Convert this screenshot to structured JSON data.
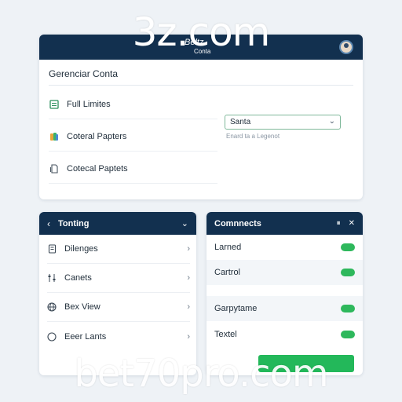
{
  "watermarks": {
    "top": "3z.com",
    "bottom": "bet70pro.com"
  },
  "top_card": {
    "logo": "Beltz",
    "logo_sub": "Conta",
    "title": "Gerenciar Conta",
    "rows": [
      {
        "label": "Full Limites",
        "icon": "sheet-icon"
      },
      {
        "label": "Coteral Papters",
        "icon": "color-swatch-icon"
      },
      {
        "label": "Cotecal Paptets",
        "icon": "file-icon"
      }
    ],
    "select": {
      "value": "Santa"
    },
    "select_hint": "Enard ta a Legenot"
  },
  "left_card": {
    "title": "Tonting",
    "items": [
      {
        "label": "Dilenges",
        "icon": "document-icon"
      },
      {
        "label": "Canets",
        "icon": "sliders-icon"
      },
      {
        "label": "Bex View",
        "icon": "globe-icon"
      },
      {
        "label": "Eeer Lants",
        "icon": "circle-icon"
      }
    ]
  },
  "right_card": {
    "title": "Comnnects",
    "toggles": [
      {
        "label": "Larned",
        "on": true
      },
      {
        "label": "Cartrol",
        "on": true
      },
      {
        "label": "Garpytame",
        "on": true
      },
      {
        "label": "Textel",
        "on": true
      }
    ]
  },
  "colors": {
    "navy": "#12304f",
    "accent_green": "#2eb85c",
    "background": "#eef2f6"
  }
}
